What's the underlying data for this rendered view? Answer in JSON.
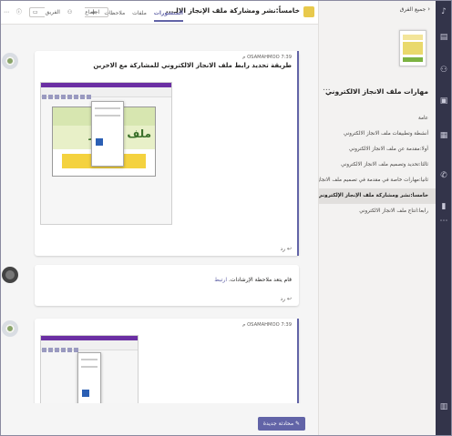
{
  "pane": {
    "back_label": "جميع الفرق",
    "team_name": "مهارات ملف الانجاز الالكتروني",
    "more": "...",
    "channels": [
      {
        "label": "عامة"
      },
      {
        "label": "أنشطة وتطبيقات ملف الانجاز الالكتروني"
      },
      {
        "label": "أولا:مقدمة عن ملف الانجاز الالكتروني"
      },
      {
        "label": "ثالثا:تحديد وتصميم ملف الانجاز الالكتروني"
      },
      {
        "label": "ثانيا:مهارات خاصة في مقدمة في تصميم ملف الانجاز"
      },
      {
        "label": "خامسا:نشر ومشاركة ملف الإنجاز الإلكتروني"
      },
      {
        "label": "رابعا:انتاج ملف الانجاز الالكتروني"
      }
    ]
  },
  "header": {
    "channel_title": "خامساً:نشر ومشاركة ملف الإنجاز الالـ...",
    "tabs": [
      "المنشورات",
      "ملفات",
      "ملاحظات"
    ],
    "add_tab": "+",
    "team_button": "الفريق",
    "meet_button": "اجتماع"
  },
  "posts": [
    {
      "author": "OSAMAHMOO",
      "time": "7:39 م",
      "title": "طريقة تحديد رابط ملف الانجاز الالكتروني للمشاركة مع الاخرين",
      "slide_text": "ملف الإنجاز",
      "reply_label": "رد"
    },
    {
      "author": "OSAMAHMOO",
      "time": "7:39 م",
      "title": "",
      "slide_text": "",
      "reply_label": ""
    }
  ],
  "reply": {
    "text": "قام يتعد ملاحظة الإرشادات.",
    "link": "ارتبط",
    "reply_label": "رد"
  },
  "compose_button": "محادثة جديدة",
  "colors": {
    "accent": "#6264a7",
    "rail": "#33344a"
  }
}
